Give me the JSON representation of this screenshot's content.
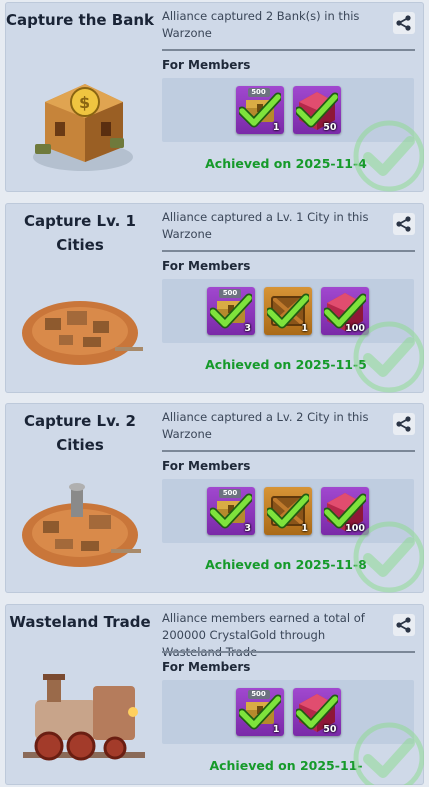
{
  "colors": {
    "achieved_text": "#169a2a",
    "item_purple": "#8d36bb",
    "item_gold": "#c47f28",
    "card_bg": "#cfd9e8"
  },
  "icons": {
    "share": "share-icon",
    "check": "check-icon",
    "watermark": "achieved-check-watermark-icon"
  },
  "achievements": [
    {
      "title": "Capture the Bank",
      "description": "Alliance captured 2 Bank(s) in this Warzone",
      "members_label": "For Members",
      "rewards": [
        {
          "type": "gold-chest",
          "plate": "500",
          "quantity": "1"
        },
        {
          "type": "red-gem",
          "quantity": "50"
        }
      ],
      "achieved": "Achieved on 2025-11-4"
    },
    {
      "title": "Capture Lv. 1 Cities",
      "description": "Alliance captured a Lv. 1 City in this Warzone",
      "members_label": "For Members",
      "rewards": [
        {
          "type": "gold-chest",
          "plate": "500",
          "quantity": "3"
        },
        {
          "type": "supply-crate",
          "quantity": "1"
        },
        {
          "type": "red-gem",
          "quantity": "100"
        }
      ],
      "achieved": "Achieved on 2025-11-5"
    },
    {
      "title": "Capture Lv. 2 Cities",
      "description": "Alliance captured a Lv. 2 City in this Warzone",
      "members_label": "For Members",
      "rewards": [
        {
          "type": "gold-chest",
          "plate": "500",
          "quantity": "3"
        },
        {
          "type": "supply-crate",
          "quantity": "1"
        },
        {
          "type": "red-gem",
          "quantity": "100"
        }
      ],
      "achieved": "Achieved on 2025-11-8"
    },
    {
      "title": "Wasteland Trade",
      "description": "Alliance members earned a total of 200000 CrystalGold through Wasteland Trade",
      "members_label": "For Members",
      "rewards": [
        {
          "type": "gold-chest",
          "plate": "500",
          "quantity": "1"
        },
        {
          "type": "red-gem",
          "quantity": "50"
        }
      ],
      "achieved": "Achieved on 2025-11-"
    }
  ]
}
